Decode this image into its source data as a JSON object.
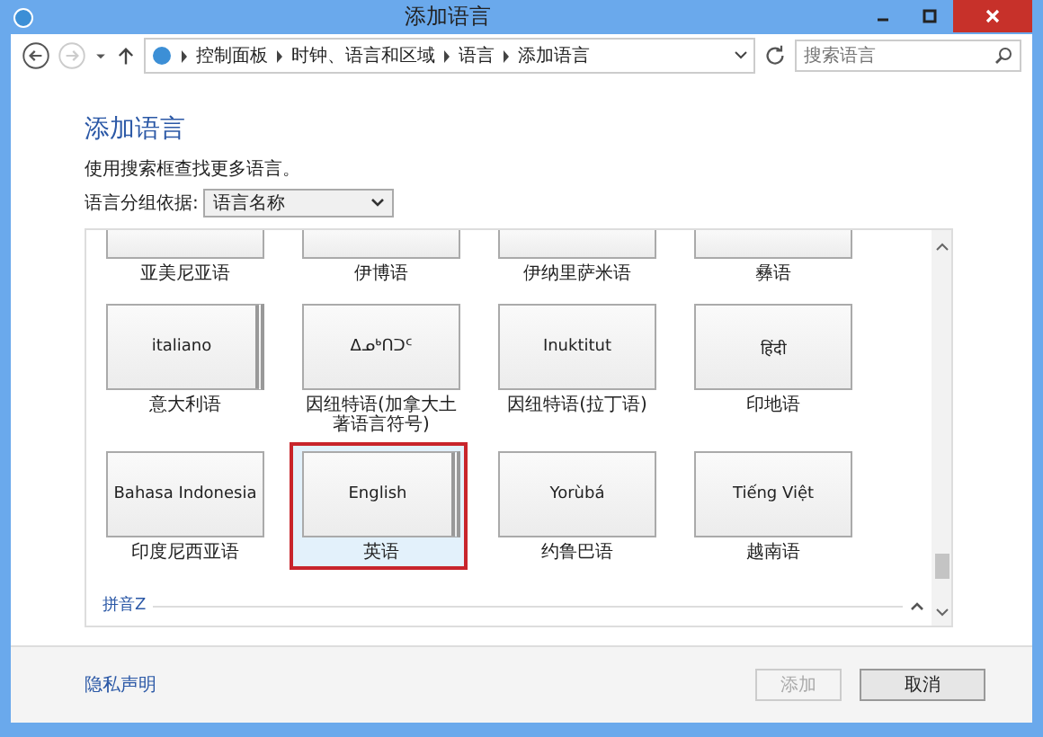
{
  "window": {
    "title": "添加语言"
  },
  "breadcrumb": [
    "控制面板",
    "时钟、语言和区域",
    "语言",
    "添加语言"
  ],
  "search": {
    "placeholder": "搜索语言"
  },
  "heading": "添加语言",
  "description": "使用搜索框查找更多语言。",
  "group_by": {
    "label": "语言分组依据:",
    "value": "语言名称"
  },
  "rows": [
    {
      "tiles": [
        {
          "label": "亚美尼亚语",
          "stacked": false,
          "selected": false
        },
        {
          "label": "伊博语",
          "stacked": false,
          "selected": false
        },
        {
          "label": "伊纳里萨米语",
          "stacked": false,
          "selected": false
        },
        {
          "label": "彝语",
          "stacked": false,
          "selected": false
        }
      ]
    },
    {
      "tiles": [
        {
          "native": "italiano",
          "label": "意大利语",
          "stacked": true,
          "selected": false
        },
        {
          "native": "ᐃᓄᒃᑎᑐᑦ",
          "label": "因纽特语(加拿大土著语言符号)",
          "stacked": false,
          "selected": false
        },
        {
          "native": "Inuktitut",
          "label": "因纽特语(拉丁语)",
          "stacked": false,
          "selected": false
        },
        {
          "native": "हिंदी",
          "label": "印地语",
          "stacked": false,
          "selected": false
        }
      ]
    },
    {
      "tiles": [
        {
          "native": "Bahasa Indonesia",
          "label": "印度尼西亚语",
          "stacked": false,
          "selected": false
        },
        {
          "native": "English",
          "label": "英语",
          "stacked": true,
          "selected": true
        },
        {
          "native": "Yorùbá",
          "label": "约鲁巴语",
          "stacked": false,
          "selected": false
        },
        {
          "native": "Tiếng Việt",
          "label": "越南语",
          "stacked": false,
          "selected": false
        }
      ]
    }
  ],
  "section": "拼音Z",
  "privacy_link": "隐私声明",
  "buttons": [
    {
      "label": "添加",
      "disabled": true
    },
    {
      "label": "取消",
      "disabled": false
    }
  ]
}
